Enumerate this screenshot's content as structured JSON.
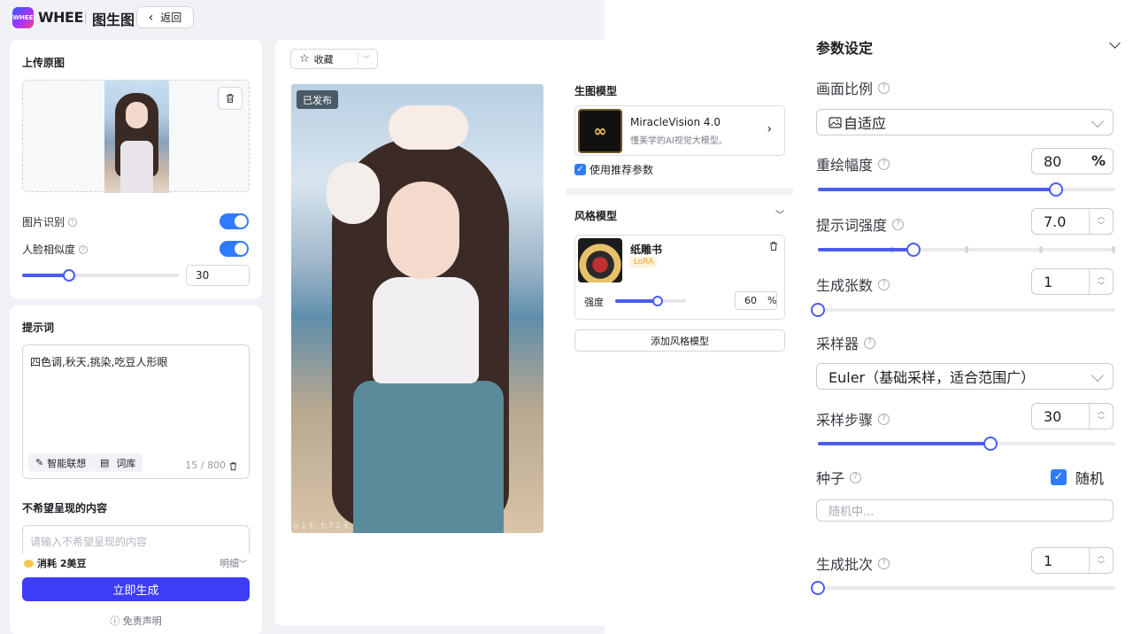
{
  "header": {
    "logo_text": "WHEE",
    "brand": "WHEE",
    "page_name": "图生图",
    "back_label": "返回"
  },
  "upload": {
    "title": "上传原图",
    "image_recognition_label": "图片识别",
    "face_similarity_label": "人脸相似度",
    "face_similarity_value": "30",
    "face_similarity_fraction": 0.3,
    "image_recognition_on": true,
    "face_similarity_on": true
  },
  "prompt": {
    "title": "提示词",
    "text": "四色调,秋天,挑染,吃豆人形眼",
    "smart_btn": "智能联想",
    "library_btn": "词库",
    "counter": "15 / 800",
    "negative_title": "不希望呈现的内容",
    "negative_placeholder": "请输入不希望呈现的内容",
    "cost": "消耗 2美豆",
    "detail": "明细",
    "generate": "立即生成",
    "disclaimer": "免责声明"
  },
  "canvas": {
    "favorite": "收藏",
    "published_badge": "已发布",
    "signature": "◎ 1 七 ·七 7 2 无"
  },
  "models": {
    "gen_title": "生图模型",
    "model_icon": "∞",
    "model_name": "MiracleVision 4.0",
    "model_desc": "懂美学的AI视觉大模型。",
    "use_recommended": "使用推荐参数",
    "style_title": "风格模型",
    "style_name": "纸雕书",
    "style_tag": "LoRA",
    "strength_label": "强度",
    "strength_value": "60",
    "strength_fraction": 0.6,
    "strength_unit": "%",
    "add_style": "添加风格模型"
  },
  "settings": {
    "title": "参数设定",
    "aspect_label": "画面比例",
    "aspect_value": "自适应",
    "redraw_label": "重绘幅度",
    "redraw_value": "80",
    "redraw_unit": "%",
    "redraw_fraction": 0.8,
    "prompt_strength_label": "提示词强度",
    "prompt_strength_value": "7.0",
    "prompt_strength_fraction": 0.32,
    "count_label": "生成张数",
    "count_value": "1",
    "count_fraction": 0,
    "sampler_label": "采样器",
    "sampler_value": "Euler（基础采样，适合范围广）",
    "steps_label": "采样步骤",
    "steps_value": "30",
    "steps_fraction": 0.58,
    "seed_label": "种子",
    "seed_random": "随机",
    "seed_placeholder": "随机中...",
    "batch_label": "生成批次",
    "batch_value": "1",
    "batch_fraction": 0
  },
  "colors": {
    "accent": "#4b5cf0",
    "toggle": "#2f7bff",
    "generate": "#3d3df5"
  },
  "icons": [
    "back-chevron-icon",
    "trash-icon",
    "help-icon",
    "star-icon",
    "chevron-right-icon",
    "chevron-down-icon",
    "image-icon",
    "check-icon"
  ]
}
